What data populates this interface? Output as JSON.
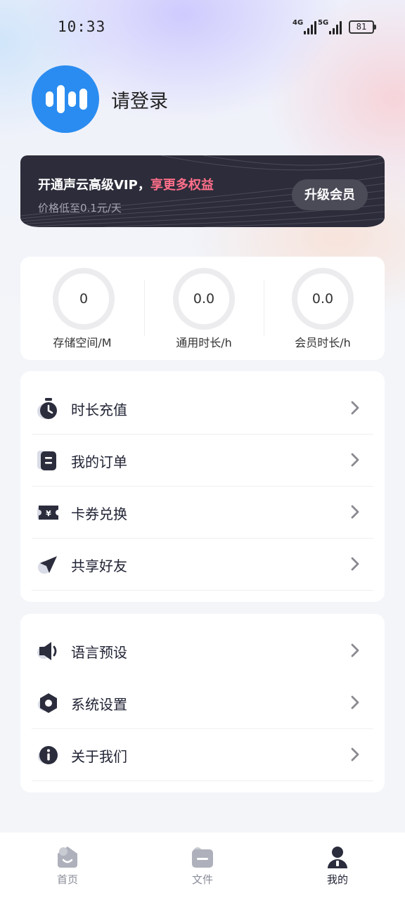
{
  "status_bar": {
    "time": "10:33",
    "network1": "4G",
    "network2": "5G",
    "battery": "81"
  },
  "profile": {
    "login_text": "请登录"
  },
  "vip_banner": {
    "title_part1": "开通声云高级VIP，",
    "title_part2": "享更多权益",
    "subtitle": "价格低至0.1元/天",
    "button_label": "升级会员",
    "highlight_color": "#ff6f8a"
  },
  "stats": [
    {
      "value": "0",
      "label": "存储空间/M"
    },
    {
      "value": "0.0",
      "label": "通用时长/h"
    },
    {
      "value": "0.0",
      "label": "会员时长/h"
    }
  ],
  "menu_primary": [
    {
      "icon": "stopwatch-icon",
      "label": "时长充值"
    },
    {
      "icon": "order-icon",
      "label": "我的订单"
    },
    {
      "icon": "coupon-icon",
      "label": "卡券兑换"
    },
    {
      "icon": "share-icon",
      "label": "共享好友"
    }
  ],
  "menu_secondary": [
    {
      "icon": "speaker-icon",
      "label": "语言预设"
    },
    {
      "icon": "settings-icon",
      "label": "系统设置"
    },
    {
      "icon": "info-icon",
      "label": "关于我们"
    }
  ],
  "tabs": [
    {
      "icon": "home-icon",
      "label": "首页",
      "active": false
    },
    {
      "icon": "file-icon",
      "label": "文件",
      "active": false
    },
    {
      "icon": "profile-icon",
      "label": "我的",
      "active": true
    }
  ],
  "colors": {
    "brand_blue": "#2a8cf0",
    "icon_dark": "#2b2d3d",
    "banner_dark": "#2c2c3a"
  }
}
